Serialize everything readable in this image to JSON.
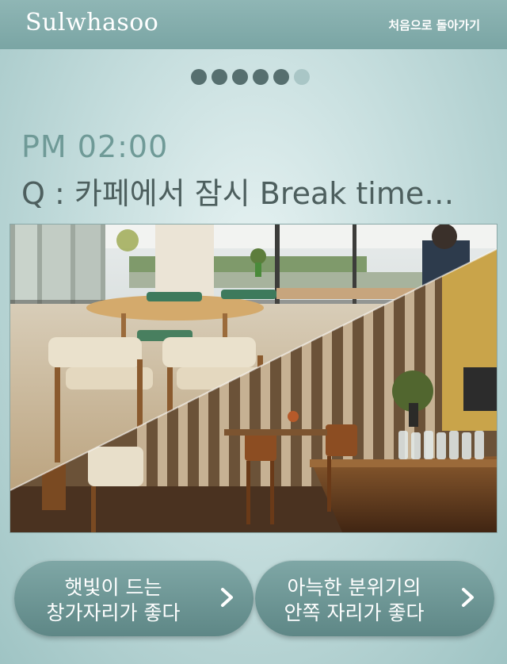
{
  "header": {
    "brand": "Sulwhasoo",
    "back_label": "처음으로 돌아가기"
  },
  "progress": {
    "total_steps": 6,
    "current_step": 5
  },
  "question": {
    "time": "PM 02:00",
    "text": "Q : 카페에서 잠시 Break time…"
  },
  "photo": {
    "icon": "cafe-split-photo"
  },
  "choices": [
    {
      "text": "햇빛이 드는\n창가자리가 좋다",
      "icon": "chevron-right-icon"
    },
    {
      "text": "아늑한 분위기의\n안쪽 자리가 좋다",
      "icon": "chevron-right-icon"
    }
  ],
  "colors": {
    "header": "#7aa5a4",
    "dot_active": "#566f6f",
    "dot_inactive": "#a9c6c6",
    "time_text": "#6f9a97",
    "question_text": "#4d5f5e",
    "button": "#6b9493"
  }
}
